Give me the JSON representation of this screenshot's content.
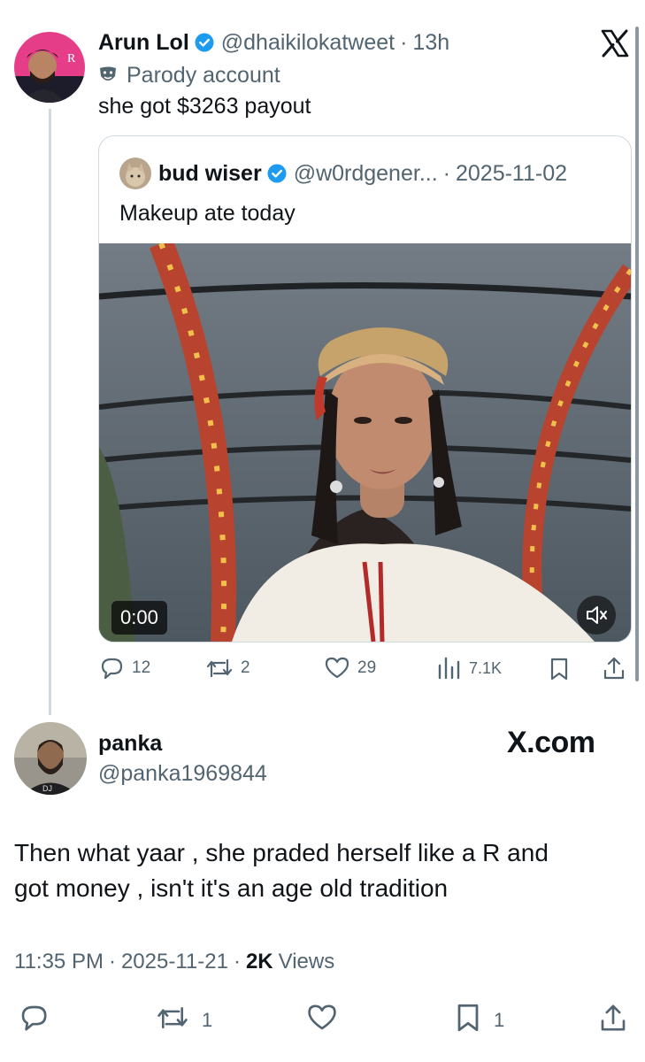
{
  "tweet": {
    "author_name": "Arun Lol",
    "handle": "@dhaikilokatweet",
    "sep": "·",
    "time": "13h",
    "label_icon": "theater-mask-icon",
    "label": "Parody account",
    "text": "she got $3263 payout"
  },
  "quoted": {
    "author_name": "bud wiser",
    "handle": "@w0rdgener...",
    "sep": "·",
    "date": "2025-11-02",
    "text": "Makeup ate today",
    "video_time": "0:00"
  },
  "tweet_actions": {
    "replies": "12",
    "reposts": "2",
    "likes": "29",
    "views": "7.1K"
  },
  "reply": {
    "author_name": "panka",
    "handle": "@panka1969844",
    "watermark": "X.com",
    "text_line1": "Then what yaar , she praded herself like a R and",
    "text_line2": "got money , isn't it's an age old tradition",
    "time": "11:35 PM",
    "sep1": "·",
    "date": "2025-11-21",
    "sep2": "·",
    "views_count": "2K",
    "views_label": "Views"
  },
  "reply_actions": {
    "reposts": "1",
    "bookmarks": "1"
  },
  "colors": {
    "verified": "#1d9bf0",
    "muted": "#536471",
    "text": "#0f1419",
    "border": "#cfd9de"
  }
}
